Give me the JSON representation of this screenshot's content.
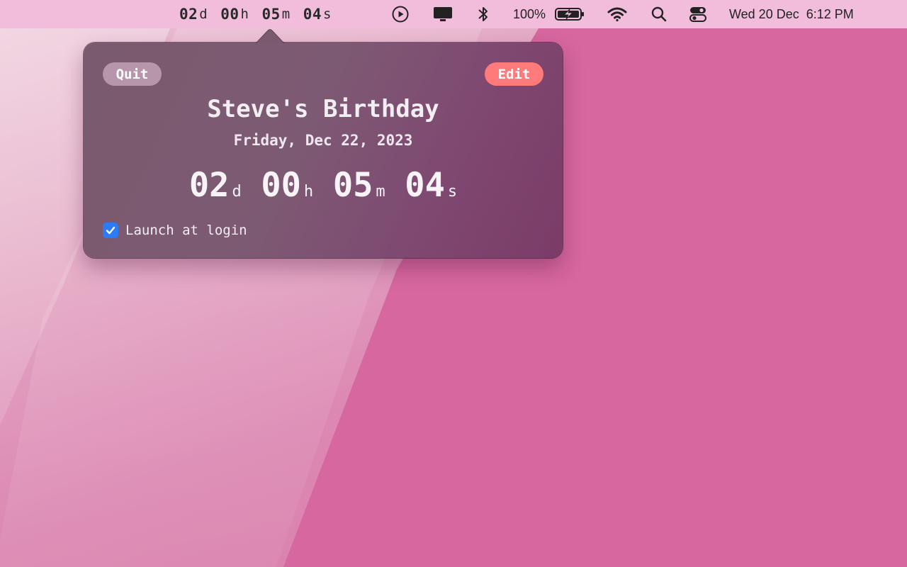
{
  "menubar": {
    "countdown": {
      "days": "02",
      "days_unit": "d",
      "hours": "00",
      "hours_unit": "h",
      "minutes": "05",
      "minutes_unit": "m",
      "seconds": "04",
      "seconds_unit": "s"
    },
    "icons": [
      "play-circle-icon",
      "display-icon",
      "bluetooth-icon",
      "battery-charging-icon",
      "wifi-icon",
      "search-icon",
      "control-center-icon"
    ],
    "battery_percent": "100%",
    "datetime": "Wed 20 Dec  6:12 PM"
  },
  "popover": {
    "quit_label": "Quit",
    "edit_label": "Edit",
    "event_title": "Steve's Birthday",
    "event_date": "Friday, Dec 22, 2023",
    "countdown": {
      "days": "02",
      "days_unit": "d",
      "hours": "00",
      "hours_unit": "h",
      "minutes": "05",
      "minutes_unit": "m",
      "seconds": "04",
      "seconds_unit": "s"
    },
    "launch_at_login_label": "Launch at login",
    "launch_at_login_checked": true
  },
  "colors": {
    "edit_accent": "#ff7b7b",
    "checkbox_accent": "#2b7cf6",
    "wallpaper": "#d6679f"
  }
}
